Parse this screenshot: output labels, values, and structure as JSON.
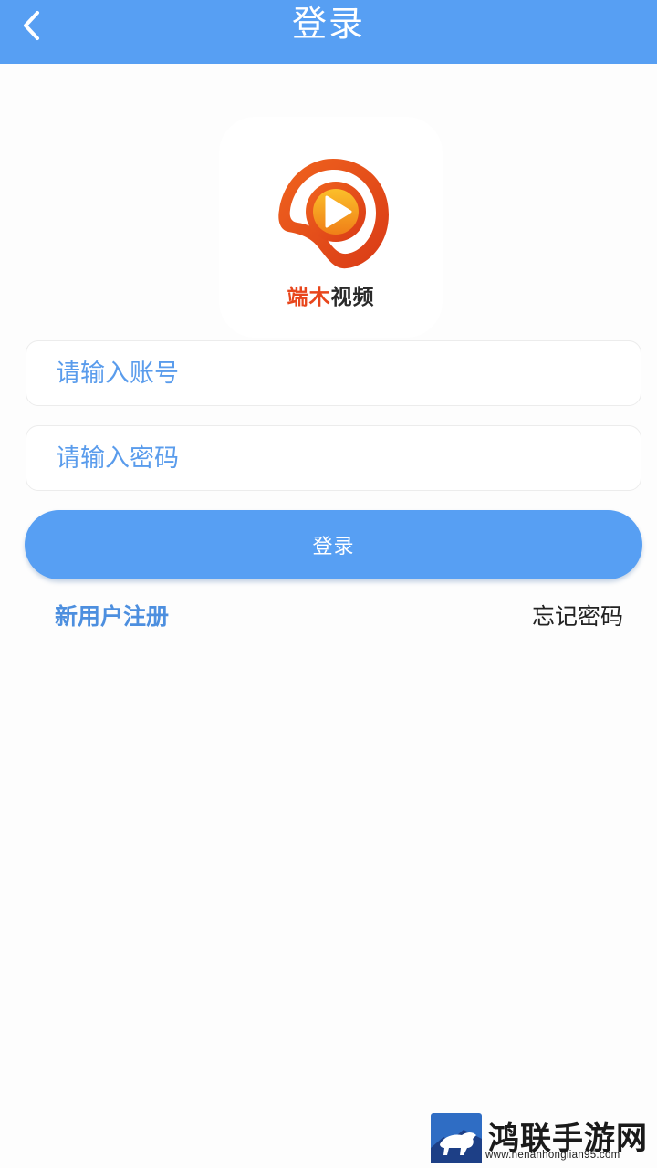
{
  "app_bar": {
    "title": "登录",
    "back_icon": "chevron-left-icon",
    "background": "#579ff3"
  },
  "logo": {
    "name_accent": "端木",
    "name_rest": "视频",
    "icon": "play-icon",
    "brand_colors": [
      "#e8461c",
      "#f29a1c"
    ]
  },
  "form": {
    "account_placeholder": "请输入账号",
    "account_value": "",
    "password_placeholder": "请输入密码",
    "password_value": "",
    "login_label": "登录"
  },
  "links": {
    "register": "新用户注册",
    "forgot_password": "忘记密码"
  },
  "watermark": {
    "name": "鸿联手游网",
    "url": "www.henanhonglian95.com"
  }
}
